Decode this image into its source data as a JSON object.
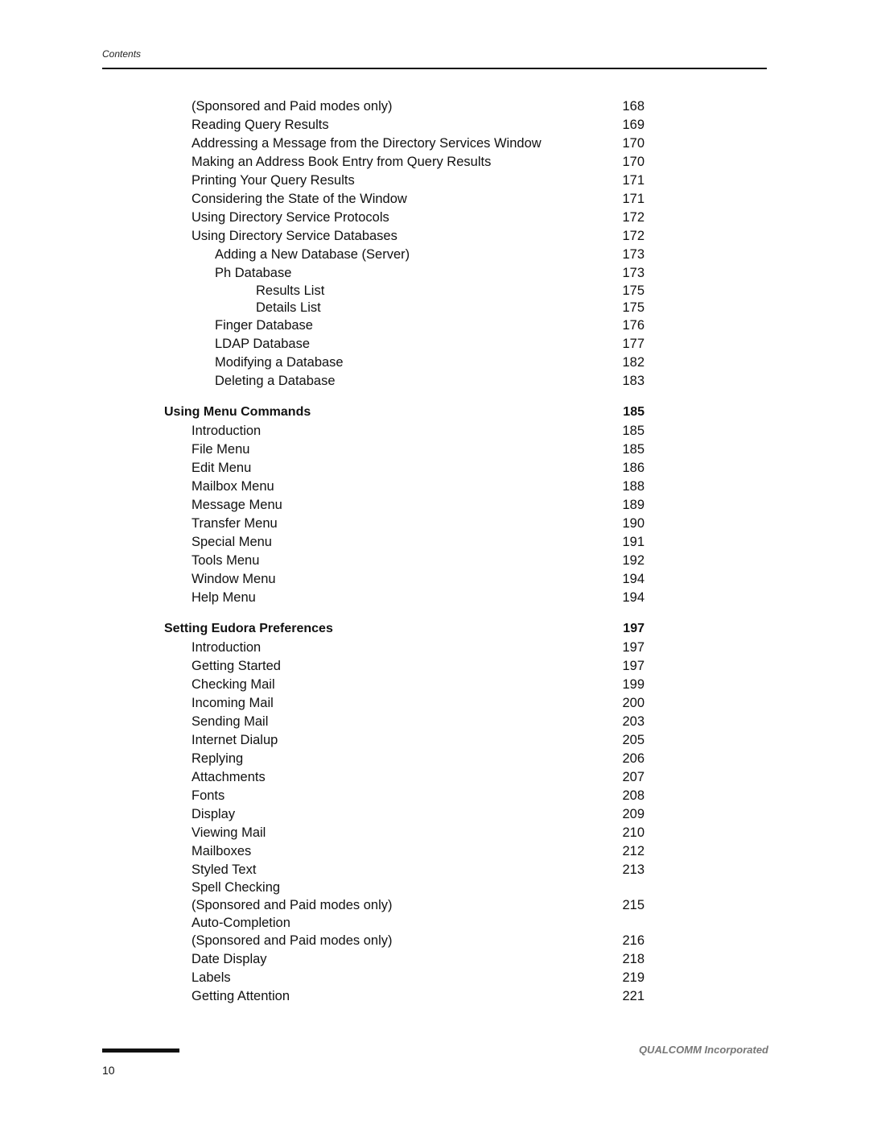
{
  "header": {
    "running_head": "Contents"
  },
  "toc": [
    {
      "level": 1,
      "title": "(Sponsored and Paid modes only)",
      "page": "168"
    },
    {
      "level": 1,
      "title": "Reading Query Results",
      "page": "169"
    },
    {
      "level": 1,
      "title": "Addressing a Message from the Directory Services Window",
      "page": "170"
    },
    {
      "level": 1,
      "title": "Making an Address Book Entry from Query Results",
      "page": "170"
    },
    {
      "level": 1,
      "title": "Printing Your Query Results",
      "page": "171"
    },
    {
      "level": 1,
      "title": "Considering the State of the Window",
      "page": "171"
    },
    {
      "level": 1,
      "title": "Using Directory Service Protocols",
      "page": "172"
    },
    {
      "level": 1,
      "title": "Using Directory Service Databases",
      "page": "172"
    },
    {
      "level": 2,
      "title": "Adding a New Database (Server)",
      "page": "173"
    },
    {
      "level": 2,
      "title": "Ph Database",
      "page": "173"
    },
    {
      "level": 3,
      "title": "Results List",
      "page": "175"
    },
    {
      "level": 3,
      "title": "Details List",
      "page": "175"
    },
    {
      "level": 2,
      "title": "Finger Database",
      "page": "176"
    },
    {
      "level": 2,
      "title": "LDAP Database",
      "page": "177"
    },
    {
      "level": 2,
      "title": "Modifying a Database",
      "page": "182"
    },
    {
      "level": 2,
      "title": "Deleting a Database",
      "page": "183"
    },
    {
      "level": 0,
      "title": "Using Menu Commands",
      "page": "185"
    },
    {
      "level": 1,
      "title": "Introduction",
      "page": "185"
    },
    {
      "level": 1,
      "title": "File Menu",
      "page": "185"
    },
    {
      "level": 1,
      "title": "Edit Menu",
      "page": "186"
    },
    {
      "level": 1,
      "title": "Mailbox Menu",
      "page": "188"
    },
    {
      "level": 1,
      "title": "Message Menu",
      "page": "189"
    },
    {
      "level": 1,
      "title": "Transfer Menu",
      "page": "190"
    },
    {
      "level": 1,
      "title": "Special Menu",
      "page": "191"
    },
    {
      "level": 1,
      "title": "Tools Menu",
      "page": "192"
    },
    {
      "level": 1,
      "title": "Window Menu",
      "page": "194"
    },
    {
      "level": 1,
      "title": "Help Menu",
      "page": "194"
    },
    {
      "level": 0,
      "title": "Setting Eudora Preferences",
      "page": "197"
    },
    {
      "level": 1,
      "title": "Introduction",
      "page": "197"
    },
    {
      "level": 1,
      "title": "Getting Started",
      "page": "197"
    },
    {
      "level": 1,
      "title": "Checking Mail",
      "page": "199"
    },
    {
      "level": 1,
      "title": "Incoming Mail",
      "page": "200"
    },
    {
      "level": 1,
      "title": "Sending Mail",
      "page": "203"
    },
    {
      "level": 1,
      "title": "Internet Dialup",
      "page": "205"
    },
    {
      "level": 1,
      "title": "Replying",
      "page": "206"
    },
    {
      "level": 1,
      "title": "Attachments",
      "page": "207"
    },
    {
      "level": 1,
      "title": "Fonts",
      "page": "208"
    },
    {
      "level": 1,
      "title": "Display",
      "page": "209"
    },
    {
      "level": 1,
      "title": "Viewing Mail",
      "page": "210"
    },
    {
      "level": 1,
      "title": "Mailboxes",
      "page": "212"
    },
    {
      "level": 1,
      "title": "Styled Text",
      "page": "213"
    },
    {
      "level": 1,
      "title": "Spell Checking",
      "page": "",
      "continued": true
    },
    {
      "level": 1,
      "title": "(Sponsored and Paid modes only)",
      "page": "215"
    },
    {
      "level": 1,
      "title": "Auto-Completion",
      "page": "",
      "continued": true
    },
    {
      "level": 1,
      "title": "(Sponsored and Paid modes only)",
      "page": "216"
    },
    {
      "level": 1,
      "title": "Date Display",
      "page": "218"
    },
    {
      "level": 1,
      "title": "Labels",
      "page": "219"
    },
    {
      "level": 1,
      "title": "Getting Attention",
      "page": "221"
    }
  ],
  "footer": {
    "company": "QUALCOMM Incorporated",
    "page_number": "10"
  }
}
